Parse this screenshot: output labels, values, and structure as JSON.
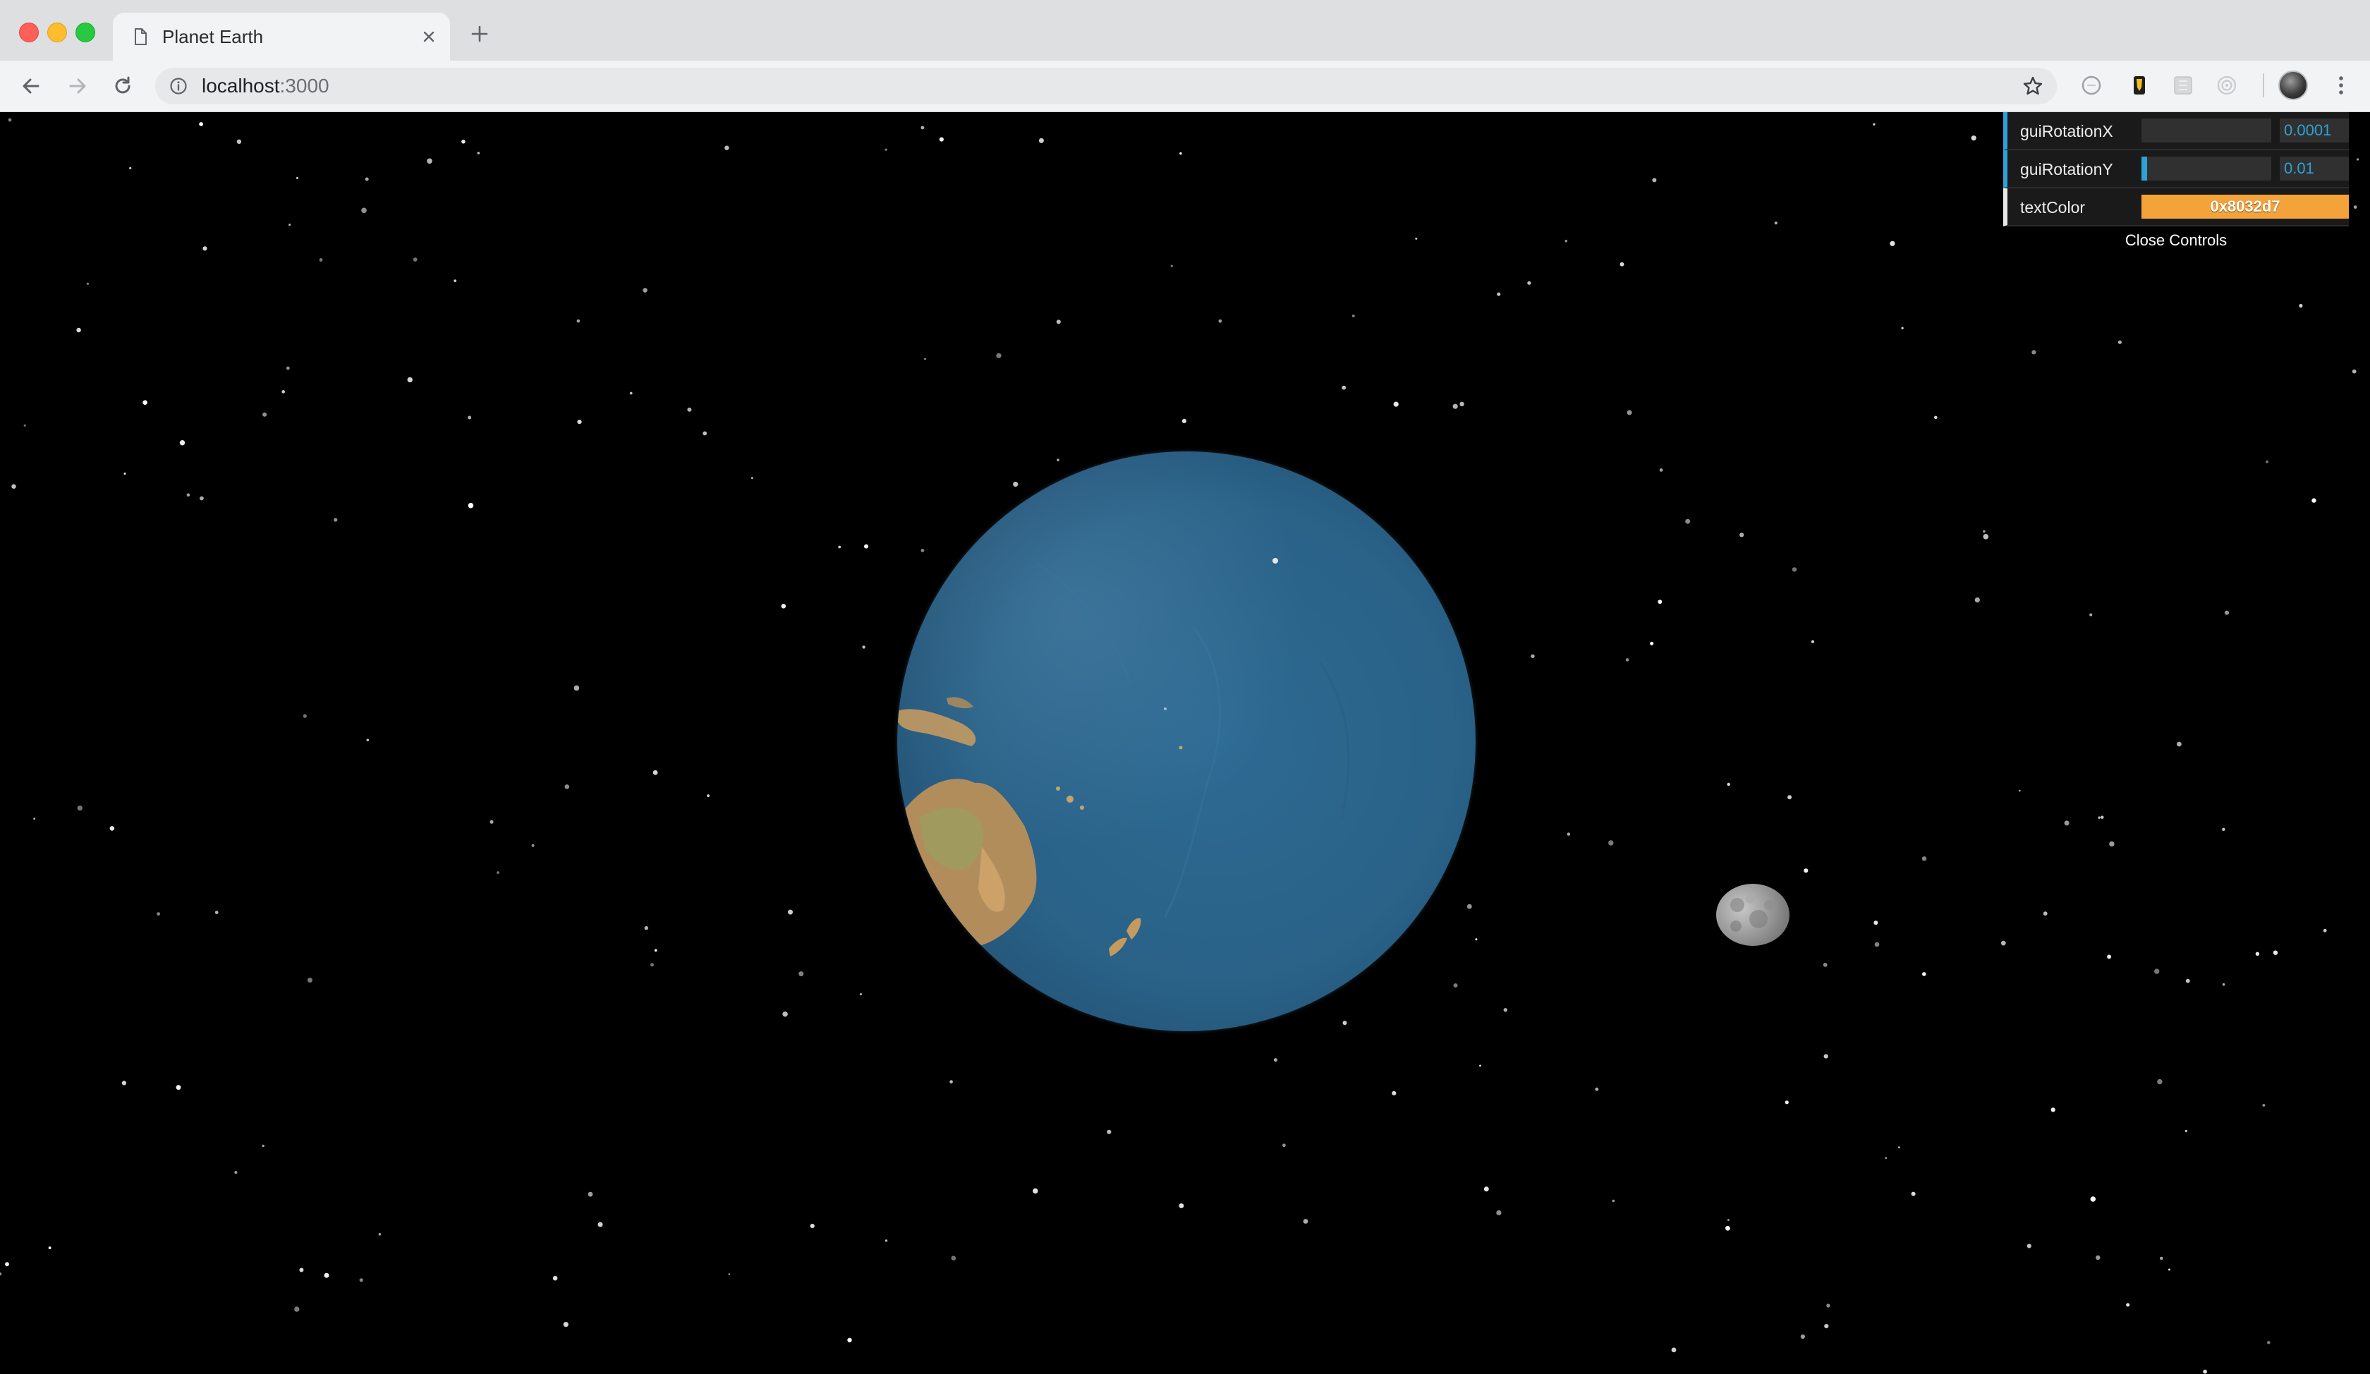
{
  "browser": {
    "tab_title": "Planet Earth",
    "url_host": "localhost",
    "url_port": ":3000",
    "icons": {
      "page": "page-icon",
      "close": "close-icon",
      "new_tab": "plus-icon",
      "back": "back-arrow-icon",
      "forward": "forward-arrow-icon",
      "reload": "reload-icon",
      "info": "info-icon",
      "bookmark": "star-icon",
      "menu": "kebab-menu-icon"
    },
    "window_controls": [
      "close",
      "minimize",
      "maximize"
    ]
  },
  "gui": {
    "controls": [
      {
        "label": "guiRotationX",
        "value": "0.0001",
        "fill": 0.0
      },
      {
        "label": "guiRotationY",
        "value": "0.01",
        "fill": 0.03
      }
    ],
    "color_control": {
      "label": "textColor",
      "value": "0x8032d7",
      "swatch": "#f4a23a"
    },
    "close_label": "Close Controls",
    "accent": "#2fa1d6"
  },
  "scene": {
    "objects": [
      "earth",
      "moon",
      "starfield"
    ]
  }
}
